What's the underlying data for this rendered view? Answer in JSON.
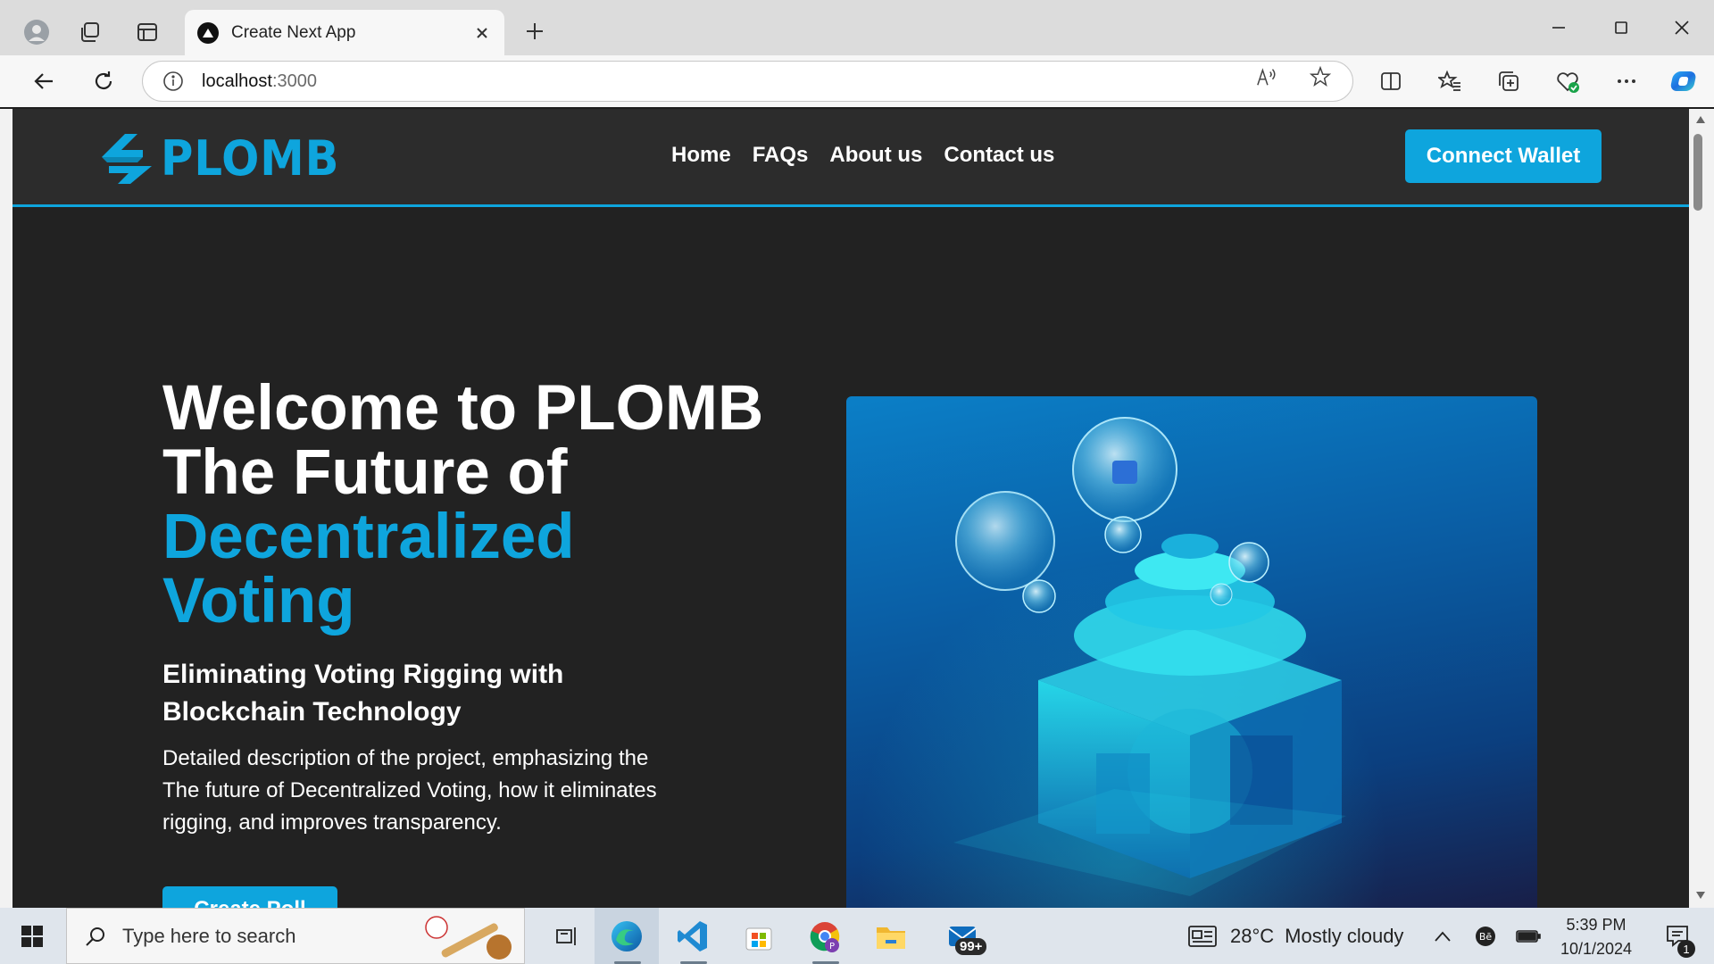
{
  "browser": {
    "tab_title": "Create Next App",
    "url_host": "localhost",
    "url_port": ":3000"
  },
  "site": {
    "logo_text": "PLOMB",
    "nav": [
      "Home",
      "FAQs",
      "About us",
      "Contact us"
    ],
    "connect_wallet_label": "Connect Wallet"
  },
  "hero": {
    "heading_line1": "Welcome to PLOMB",
    "heading_line2": "The Future of",
    "heading_accent1": "Decentralized",
    "heading_accent2": "Voting",
    "subheading": "Eliminating Voting Rigging with Blockchain Technology",
    "description": "Detailed description of the project, emphasizing the The future of Decentralized Voting, how it eliminates rigging, and improves transparency.",
    "cta_label": "Create Poll"
  },
  "taskbar": {
    "search_placeholder": "Type here to search",
    "weather_temp": "28°C",
    "weather_desc": "Mostly cloudy",
    "time": "5:39 PM",
    "date": "10/1/2024",
    "mail_badge": "99+",
    "notification_count": "1"
  },
  "colors": {
    "accent": "#0ea5dd",
    "page_bg": "#222222",
    "header_bg": "#2c2c2c"
  }
}
